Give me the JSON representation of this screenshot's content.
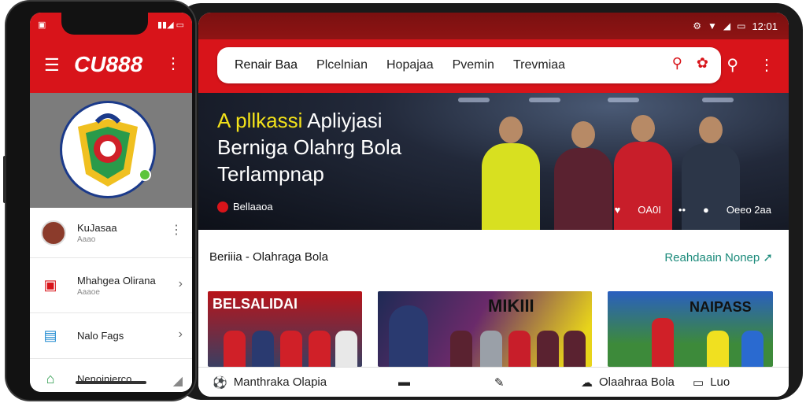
{
  "tablet": {
    "status_time": "12:01",
    "tabs": [
      "Renair Baa",
      "Plcelnian",
      "Hopajaa",
      "Pvemin",
      "Trevmiaa"
    ],
    "hero": {
      "title_highlight": "A pllkassi",
      "title_rest_line1": " Apliyjasi",
      "title_line2": "Berniga Olahrg Bola",
      "title_line3": "Terlampnap",
      "source": "Bellaaoa",
      "likes": "OA0I",
      "comments_label": "Oeeo 2aa"
    },
    "news": {
      "heading": "Beriiia - Olahraga Bola",
      "more_link": "Reahdaain Nonep",
      "cards": [
        {
          "banner": "BELSALIDAI"
        },
        {
          "banner": "MIKIII"
        },
        {
          "banner": "NAIPASS"
        }
      ]
    },
    "bottom_nav": {
      "item1": "Manthraka Olapia",
      "item2": "Olaahraa Bola",
      "item3": "Luo"
    }
  },
  "phone": {
    "app_title": "CU888",
    "profile": {
      "name": "KuJasaa",
      "sub": "Aaao"
    },
    "menu": [
      {
        "label": "Mhahgea Olirana",
        "sub": "Aaaoe"
      },
      {
        "label": "Nalo Fags",
        "sub": ""
      },
      {
        "label": "Nenoinierco",
        "sub": ""
      }
    ]
  },
  "colors": {
    "brand_red": "#d8141a",
    "link_teal": "#1a8a7a",
    "hero_yellow": "#f3e21a"
  }
}
